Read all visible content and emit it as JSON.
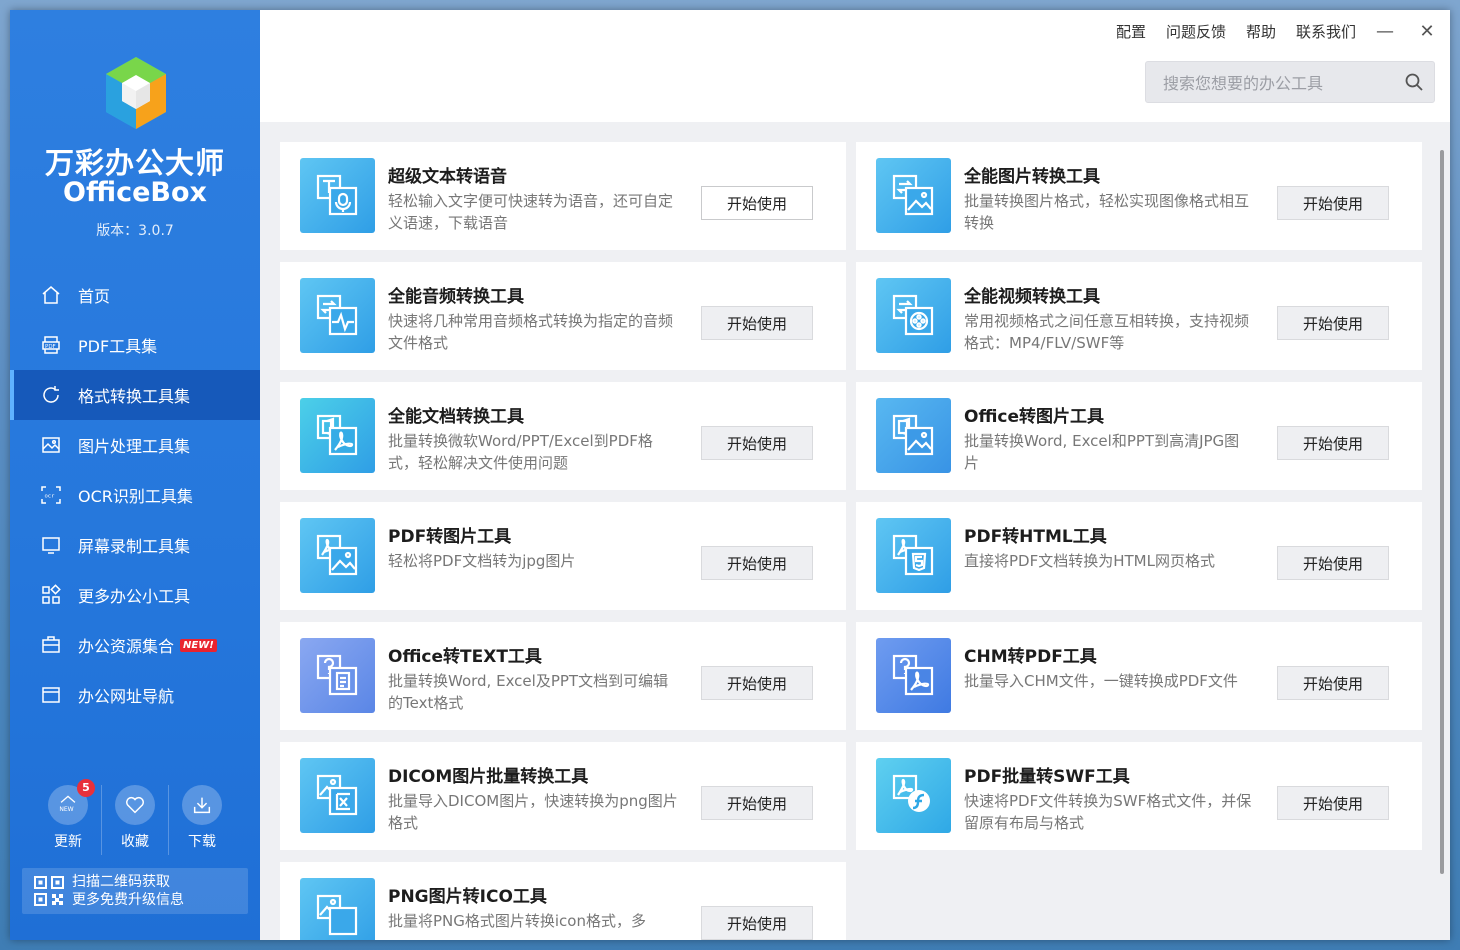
{
  "app": {
    "name_cn": "万彩办公大师",
    "name_en": "OfficeBox",
    "version": "版本：3.0.7"
  },
  "nav": [
    {
      "label": "首页",
      "icon": "home-icon"
    },
    {
      "label": "PDF工具集",
      "icon": "pdf-icon"
    },
    {
      "label": "格式转换工具集",
      "icon": "convert-icon",
      "active": true
    },
    {
      "label": "图片处理工具集",
      "icon": "image-icon"
    },
    {
      "label": "OCR识别工具集",
      "icon": "ocr-icon"
    },
    {
      "label": "屏幕录制工具集",
      "icon": "monitor-icon"
    },
    {
      "label": "更多办公小工具",
      "icon": "apps-icon"
    },
    {
      "label": "办公资源集合",
      "icon": "briefcase-icon",
      "badge": "NEW!"
    },
    {
      "label": "办公网址导航",
      "icon": "browser-icon"
    }
  ],
  "bottom": {
    "update_label": "更新",
    "update_count": "5",
    "update_new": "NEW",
    "favorite_label": "收藏",
    "download_label": "下载",
    "qr_line1": "扫描二维码获取",
    "qr_line2": "更多免费升级信息"
  },
  "topbar": {
    "menu": [
      "配置",
      "问题反馈",
      "帮助",
      "联系我们"
    ],
    "minimize": "—",
    "close": "✕",
    "search_placeholder": "搜索您想要的办公工具"
  },
  "cards": [
    {
      "title": "超级文本转语音",
      "desc": "轻松输入文字便可快速转为语音，还可自定义语速，下载语音",
      "button": "开始使用",
      "icon": "text-to-speech-icon"
    },
    {
      "title": "全能图片转换工具",
      "desc": "批量转换图片格式，轻松实现图像格式相互转换",
      "button": "开始使用",
      "icon": "image-convert-icon"
    },
    {
      "title": "全能音频转换工具",
      "desc": "快速将几种常用音频格式转换为指定的音频文件格式",
      "button": "开始使用",
      "icon": "audio-convert-icon"
    },
    {
      "title": "全能视频转换工具",
      "desc": "常用视频格式之间任意互相转换，支持视频格式：MP4/FLV/SWF等",
      "button": "开始使用",
      "icon": "video-convert-icon"
    },
    {
      "title": "全能文档转换工具",
      "desc": "批量转换微软Word/PPT/Excel到PDF格式，轻松解决文件使用问题",
      "button": "开始使用",
      "icon": "document-convert-icon"
    },
    {
      "title": "Office转图片工具",
      "desc": "批量转换Word, Excel和PPT到高清JPG图片",
      "button": "开始使用",
      "icon": "office-to-image-icon"
    },
    {
      "title": "PDF转图片工具",
      "desc": "轻松将PDF文档转为jpg图片",
      "button": "开始使用",
      "icon": "pdf-to-image-icon"
    },
    {
      "title": "PDF转HTML工具",
      "desc": "直接将PDF文档转换为HTML网页格式",
      "button": "开始使用",
      "icon": "pdf-to-html-icon"
    },
    {
      "title": "Office转TEXT工具",
      "desc": "批量转换Word, Excel及PPT文档到可编辑的Text格式",
      "button": "开始使用",
      "icon": "office-to-text-icon"
    },
    {
      "title": "CHM转PDF工具",
      "desc": "批量导入CHM文件，一键转换成PDF文件",
      "button": "开始使用",
      "icon": "chm-to-pdf-icon"
    },
    {
      "title": "DICOM图片批量转换工具",
      "desc": "批量导入DICOM图片，快速转换为png图片格式",
      "button": "开始使用",
      "icon": "dicom-convert-icon"
    },
    {
      "title": "PDF批量转SWF工具",
      "desc": "快速将PDF文件转换为SWF格式文件，并保留原有布局与格式",
      "button": "开始使用",
      "icon": "pdf-to-swf-icon"
    },
    {
      "title": "PNG图片转ICO工具",
      "desc": "批量将PNG格式图片转换icon格式，多",
      "button": "开始使用",
      "icon": "png-to-ico-icon"
    }
  ],
  "colors": {
    "sidebar": "#2577dc",
    "sidebar_active": "#1659ba",
    "content_bg": "#eff0f3"
  }
}
